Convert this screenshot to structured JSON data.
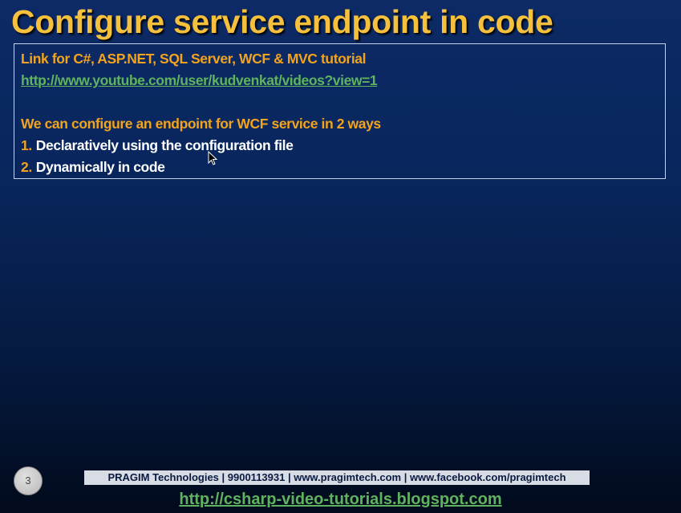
{
  "slide": {
    "title": "Configure service endpoint in code"
  },
  "content": {
    "link_intro": "Link for C#, ASP.NET, SQL Server, WCF & MVC tutorial",
    "link_url": "http://www.youtube.com/user/kudvenkat/videos?view=1",
    "intro": "We can configure an endpoint for WCF service in 2 ways",
    "items": [
      {
        "number": "1.",
        "text": "Declaratively using the configuration file"
      },
      {
        "number": "2.",
        "text": "Dynamically in code"
      }
    ]
  },
  "footer": {
    "slide_number": "3",
    "company_bar": "PRAGIM Technologies | 9900113931 | www.pragimtech.com | www.facebook.com/pragimtech",
    "blog_link": "http://csharp-video-tutorials.blogspot.com"
  },
  "colors": {
    "title": "#f5c03c",
    "accent": "#f2a41e",
    "link": "#5fb35f",
    "background": "#0d2a66"
  }
}
